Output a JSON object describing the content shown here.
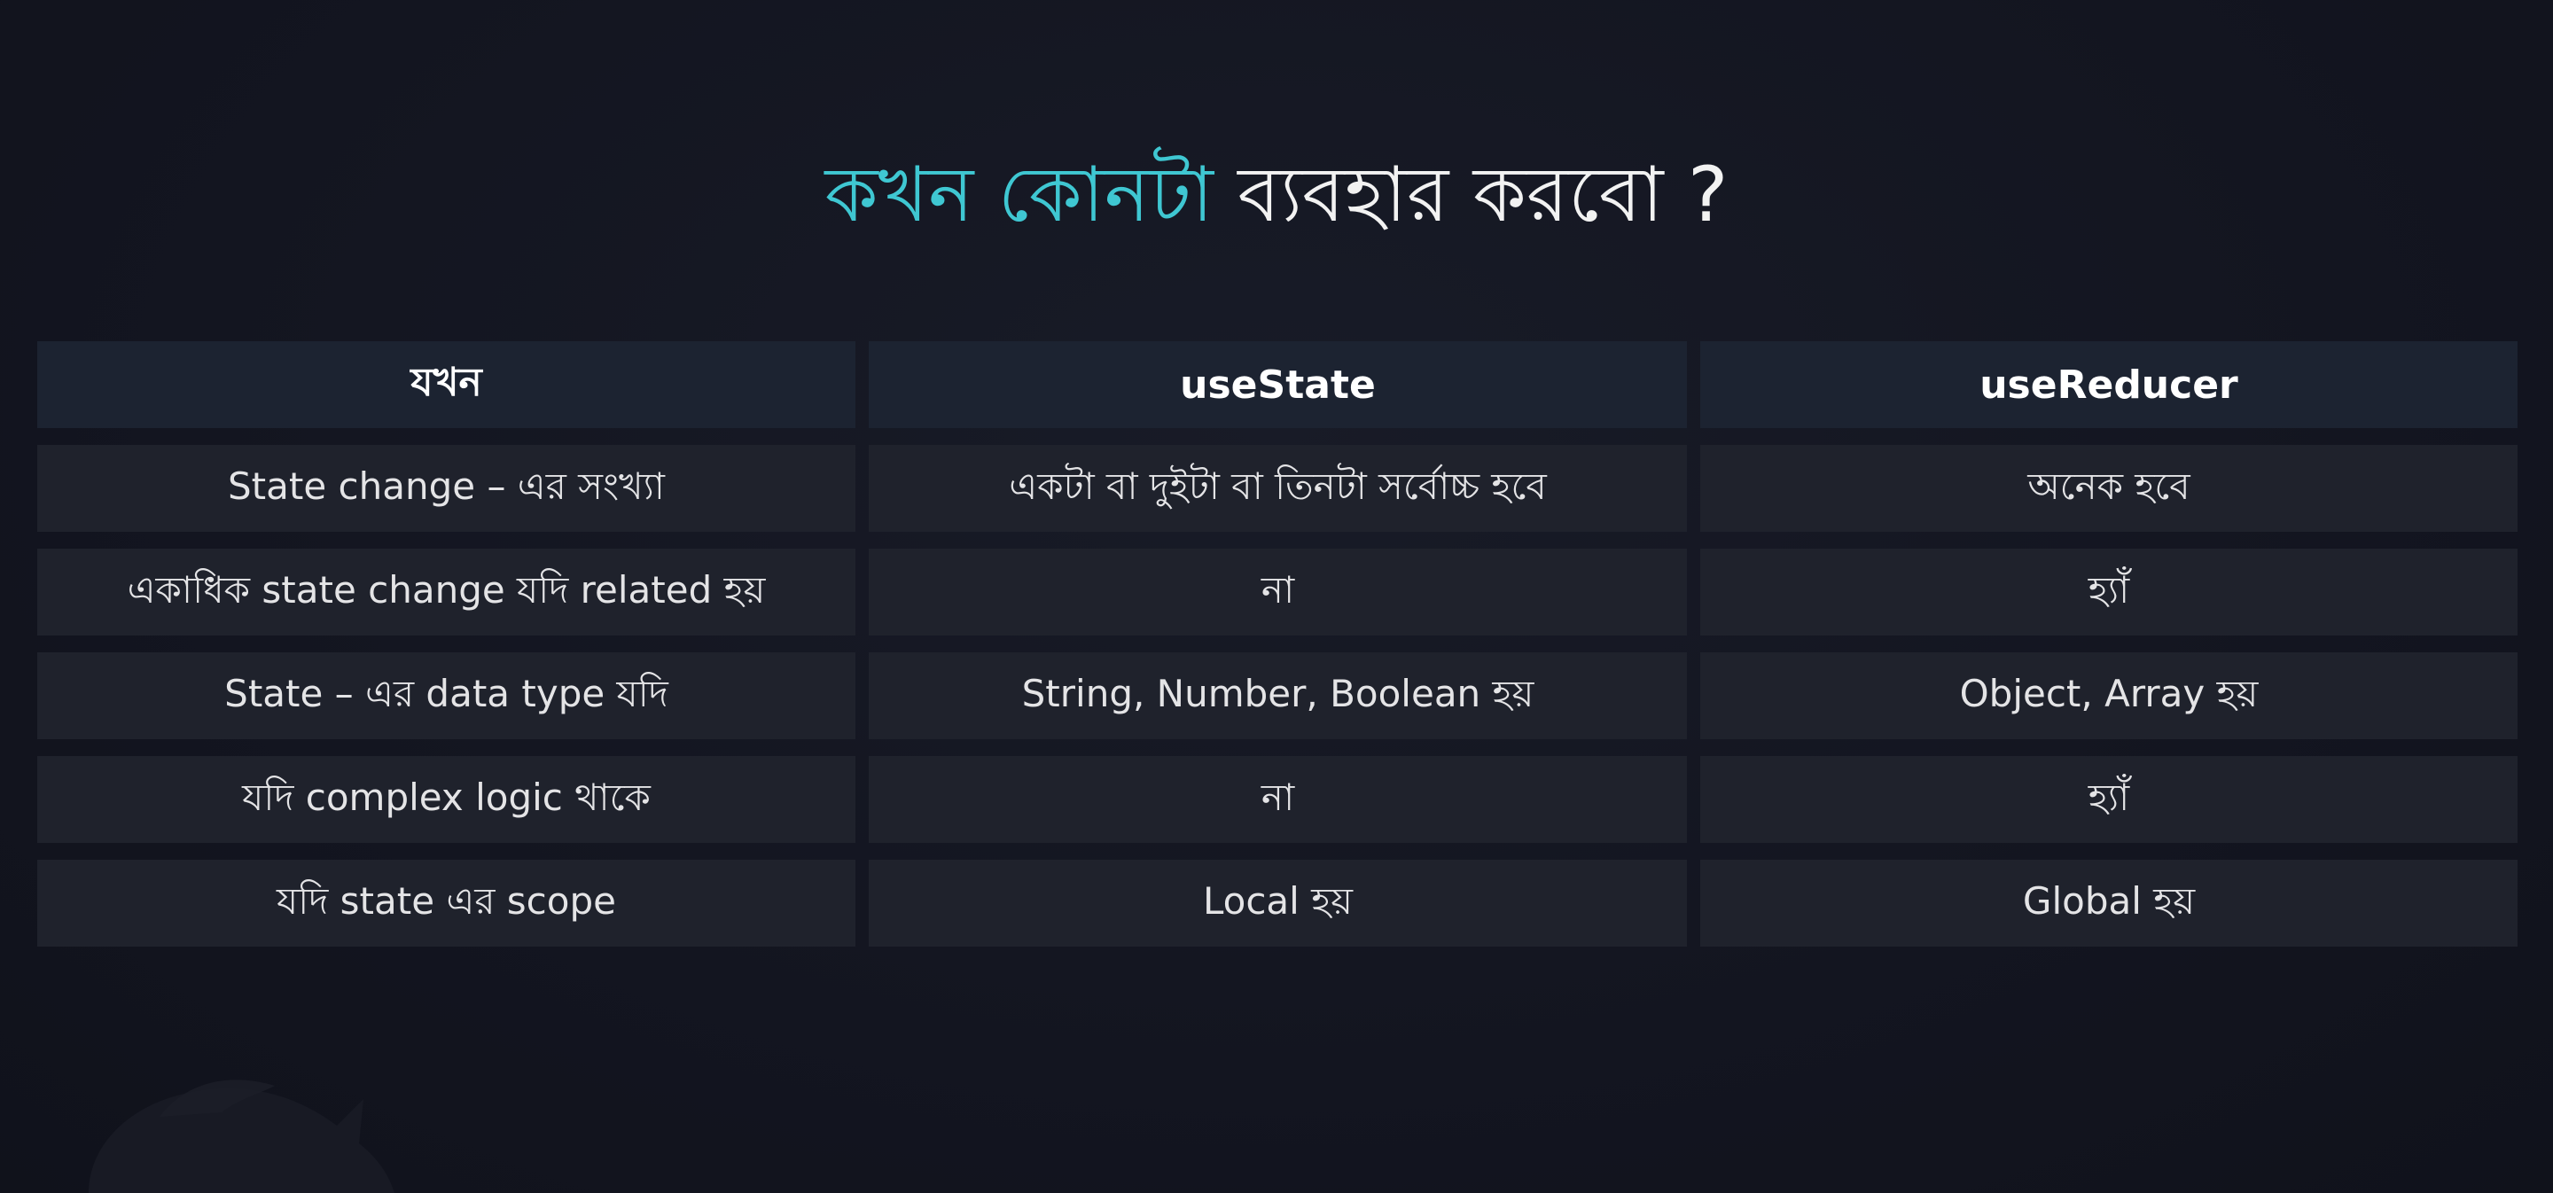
{
  "title": {
    "accent": "কখন কোনটা",
    "rest": " ব্যবহার করবো ?"
  },
  "table": {
    "headers": [
      "যখন",
      "useState",
      "useReducer"
    ],
    "rows": [
      [
        "State change – এর সংখ্যা",
        "একটা বা দুইটা বা তিনটা সর্বোচ্চ হবে",
        "অনেক হবে"
      ],
      [
        "একাধিক state change  যদি related হয়",
        "না",
        "হ্যাঁ"
      ],
      [
        "State – এর data type যদি",
        "String, Number, Boolean হয়",
        "Object, Array হয়"
      ],
      [
        "যদি complex logic থাকে",
        "না",
        "হ্যাঁ"
      ],
      [
        "যদি state এর scope",
        "Local হয়",
        "Global হয়"
      ]
    ]
  },
  "colors": {
    "background": "#141621",
    "accent": "#3fc7d2",
    "cell": "#1f222c",
    "header_cell": "#1c2331"
  },
  "icons": {
    "watermark": "logo-watermark"
  }
}
